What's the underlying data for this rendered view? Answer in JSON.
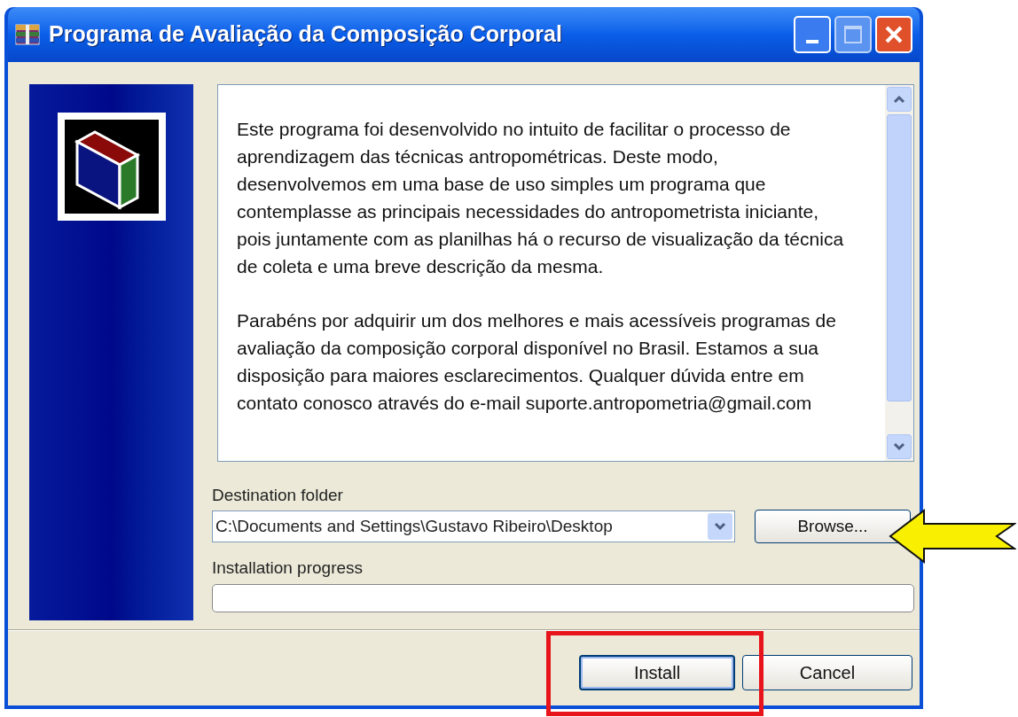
{
  "window": {
    "title": "Programa de Avaliação da Composição Corporal"
  },
  "description": {
    "paragraphs": [
      "Este programa foi desenvolvido no intuito de facilitar o processo de aprendizagem das técnicas antropométricas. Deste modo, desenvolvemos em uma base de uso simples um programa que contemplasse as principais necessidades do antropometrista iniciante, pois juntamente com as planilhas há o recurso de visualização da técnica de coleta e uma breve descrição da mesma.",
      "Parabéns por adquirir um dos melhores e mais acessíveis programas de avaliação da composição corporal disponível no Brasil. Estamos a sua disposição para maiores esclarecimentos. Qualquer dúvida entre em contato conosco através do e-mail suporte.antropometria@gmail.com"
    ]
  },
  "destination": {
    "label": "Destination folder",
    "value": "C:\\Documents and Settings\\Gustavo Ribeiro\\Desktop",
    "browse": "Browse..."
  },
  "progress": {
    "label": "Installation progress",
    "level": 0
  },
  "buttons": [
    {
      "label": "Install",
      "kind": "default"
    },
    {
      "label": "Cancel",
      "kind": "normal"
    }
  ]
}
